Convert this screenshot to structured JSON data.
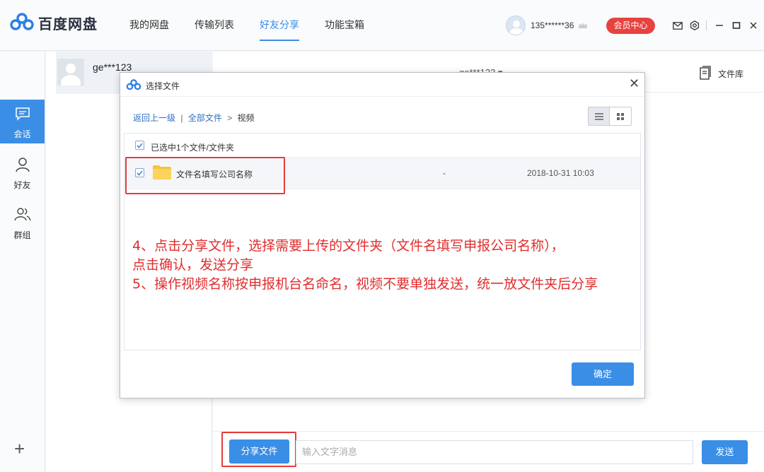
{
  "app": {
    "title": "百度网盘"
  },
  "nav": {
    "items": [
      "我的网盘",
      "传输列表",
      "好友分享",
      "功能宝箱"
    ],
    "active_index": 2
  },
  "user": {
    "name": "135******36",
    "vip_label": "会员中心"
  },
  "rail": {
    "items": [
      "会话",
      "好友",
      "群组"
    ],
    "active_index": 0
  },
  "contacts": [
    {
      "name": "ge***123"
    }
  ],
  "chat": {
    "title": "ge***123 ▾",
    "library_label": "文件库",
    "share_button": "分享文件",
    "input_placeholder": "输入文字消息",
    "send_button": "发送"
  },
  "dialog": {
    "title": "选择文件",
    "breadcrumb": {
      "back": "返回上一级",
      "sep": "|",
      "root": "全部文件",
      "arrow": ">",
      "current": "视频"
    },
    "selected_text": "已选中1个文件/文件夹",
    "files": [
      {
        "name": "文件名填写公司名称",
        "size": "-",
        "date": "2018-10-31 10:03",
        "checked": true
      }
    ],
    "annotation_lines": [
      "4、点击分享文件，选择需要上传的文件夹（文件名填写申报公司名称），",
      "点击确认，发送分享",
      "5、操作视频名称按申报机台名命名，视频不要单独发送，统一放文件夹后分享"
    ],
    "ok_button": "确定"
  },
  "colors": {
    "accent": "#3a8ee6",
    "vip": "#e64340",
    "annotation": "#e02d2d"
  }
}
